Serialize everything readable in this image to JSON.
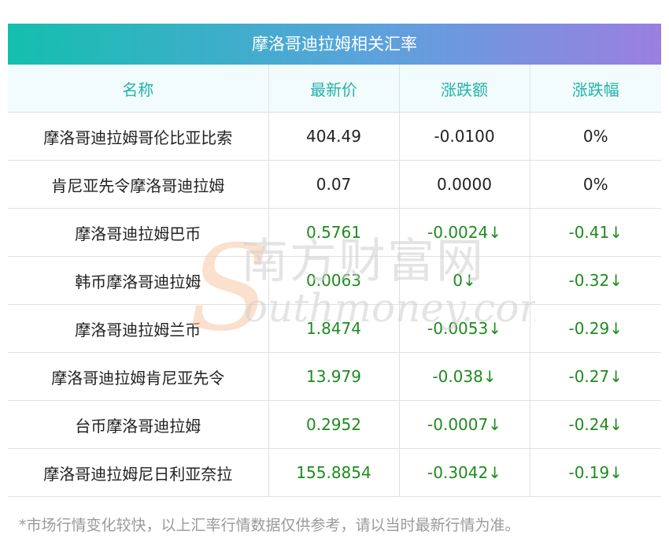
{
  "title": "摩洛哥迪拉姆相关汇率",
  "columns": [
    "名称",
    "最新价",
    "涨跌额",
    "涨跌幅"
  ],
  "rows": [
    {
      "name": "摩洛哥迪拉姆哥伦比亚比索",
      "price": "404.49",
      "change": "-0.0100",
      "pct": "0%",
      "dir": "flat"
    },
    {
      "name": "肯尼亚先令摩洛哥迪拉姆",
      "price": "0.07",
      "change": "0.0000",
      "pct": "0%",
      "dir": "flat"
    },
    {
      "name": "摩洛哥迪拉姆巴币",
      "price": "0.5761",
      "change": "-0.0024↓",
      "pct": "-0.41↓",
      "dir": "down"
    },
    {
      "name": "韩币摩洛哥迪拉姆",
      "price": "0.0063",
      "change": "0↓",
      "pct": "-0.32↓",
      "dir": "down"
    },
    {
      "name": "摩洛哥迪拉姆兰币",
      "price": "1.8474",
      "change": "-0.0053↓",
      "pct": "-0.29↓",
      "dir": "down"
    },
    {
      "name": "摩洛哥迪拉姆肯尼亚先令",
      "price": "13.979",
      "change": "-0.038↓",
      "pct": "-0.27↓",
      "dir": "down"
    },
    {
      "name": "台币摩洛哥迪拉姆",
      "price": "0.2952",
      "change": "-0.0007↓",
      "pct": "-0.24↓",
      "dir": "down"
    },
    {
      "name": "摩洛哥迪拉姆尼日利亚奈拉",
      "price": "155.8854",
      "change": "-0.3042↓",
      "pct": "-0.19↓",
      "dir": "down"
    }
  ],
  "watermark": {
    "cn": "南方财富网",
    "en": "outhmoney.com"
  },
  "footnote": "*市场行情变化较快，以上汇率行情数据仅供参考，请以当时最新行情为准。",
  "colors": {
    "header_text": "#21b3a9",
    "down": "#1f8a1f",
    "gradient_start": "#14bfae",
    "gradient_end": "#9b7fe0"
  }
}
